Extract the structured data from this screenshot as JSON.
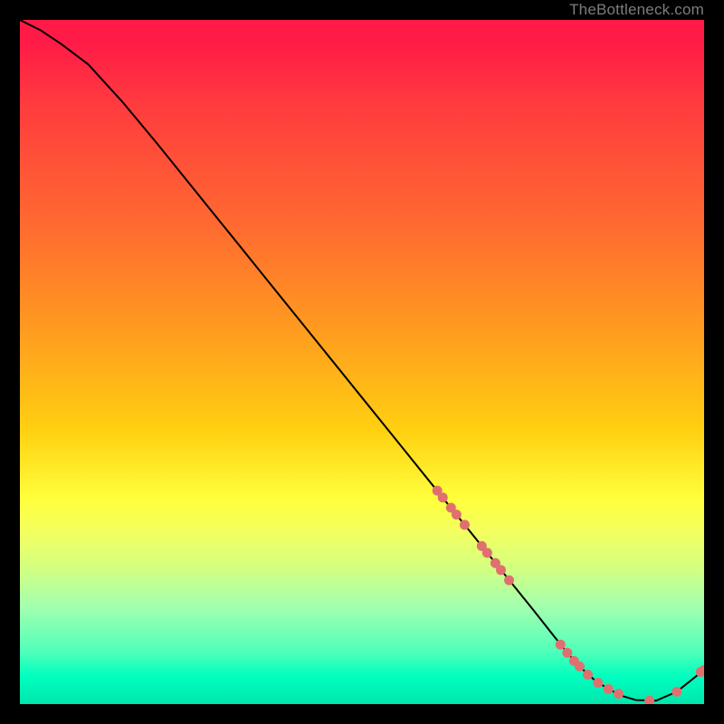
{
  "watermark": "TheBottleneck.com",
  "chart_data": {
    "type": "line",
    "title": "",
    "xlabel": "",
    "ylabel": "",
    "xlim": [
      0,
      100
    ],
    "ylim": [
      0,
      100
    ],
    "grid": false,
    "series": [
      {
        "name": "curve",
        "x": [
          0,
          3,
          6,
          10,
          15,
          20,
          25,
          30,
          35,
          40,
          45,
          50,
          55,
          60,
          65,
          70,
          75,
          78,
          80,
          82,
          84,
          86,
          88,
          90,
          93,
          96,
          100
        ],
        "y": [
          100,
          98.5,
          96.5,
          93.5,
          88,
          82,
          75.8,
          69.6,
          63.4,
          57.2,
          51,
          44.8,
          38.6,
          32.4,
          26.2,
          20,
          13.8,
          10,
          7.5,
          5.3,
          3.5,
          2.2,
          1.2,
          0.6,
          0.5,
          1.8,
          5
        ]
      }
    ],
    "markers": [
      {
        "x": 61,
        "y": 31.2
      },
      {
        "x": 61.8,
        "y": 30.2
      },
      {
        "x": 63,
        "y": 28.7
      },
      {
        "x": 63.8,
        "y": 27.7
      },
      {
        "x": 65,
        "y": 26.2
      },
      {
        "x": 67.5,
        "y": 23.1
      },
      {
        "x": 68.3,
        "y": 22.1
      },
      {
        "x": 69.5,
        "y": 20.6
      },
      {
        "x": 70.3,
        "y": 19.6
      },
      {
        "x": 71.5,
        "y": 18.1
      },
      {
        "x": 79,
        "y": 8.7
      },
      {
        "x": 80,
        "y": 7.5
      },
      {
        "x": 81,
        "y": 6.3
      },
      {
        "x": 81.8,
        "y": 5.5
      },
      {
        "x": 83,
        "y": 4.3
      },
      {
        "x": 84.5,
        "y": 3.1
      },
      {
        "x": 86,
        "y": 2.2
      },
      {
        "x": 87.5,
        "y": 1.5
      },
      {
        "x": 92,
        "y": 0.5
      },
      {
        "x": 96,
        "y": 1.8
      },
      {
        "x": 99.5,
        "y": 4.7
      },
      {
        "x": 100,
        "y": 5
      }
    ],
    "marker_color": "#e07070",
    "line_color": "#000000"
  }
}
